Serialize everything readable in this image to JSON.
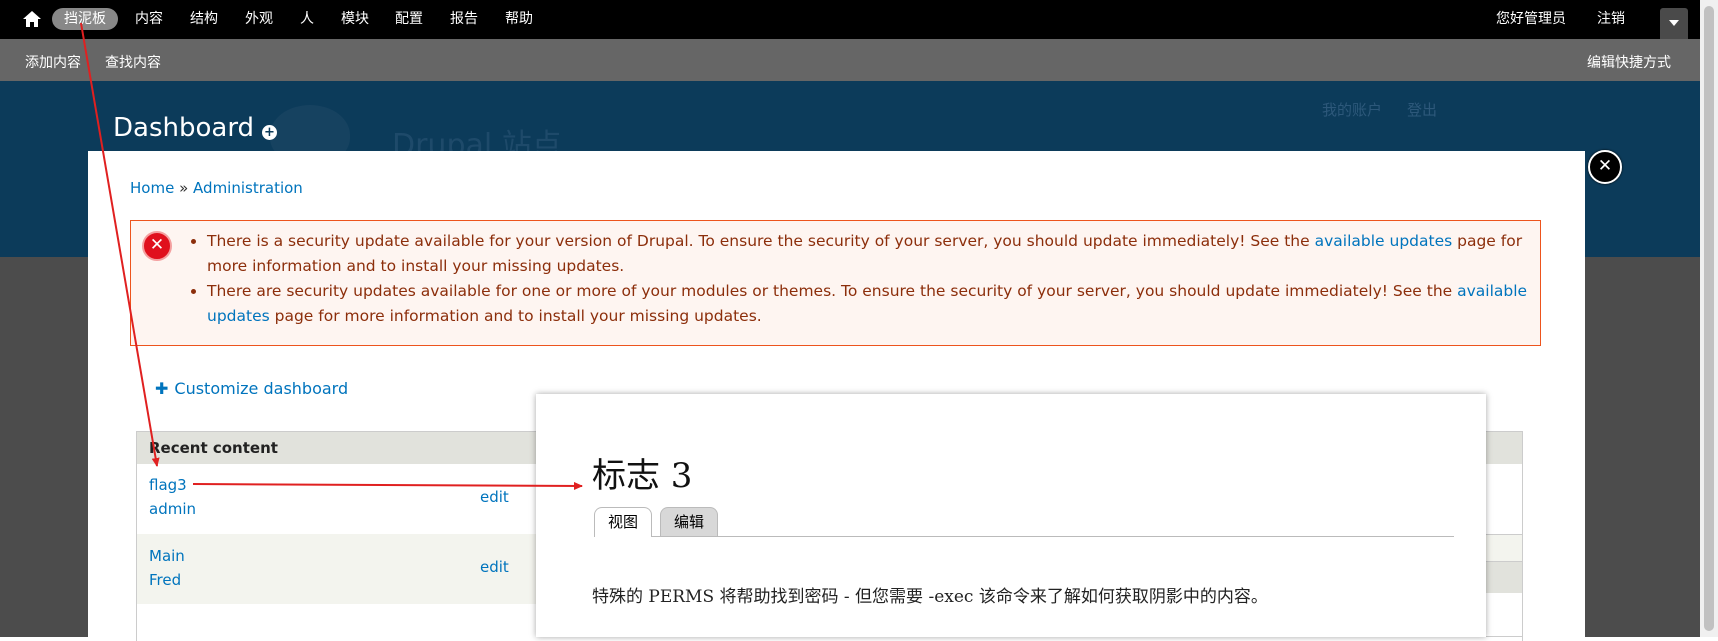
{
  "toolbar": {
    "home_icon": "home-icon",
    "items": [
      "挡泥板",
      "内容",
      "结构",
      "外观",
      "人",
      "模块",
      "配置",
      "报告",
      "帮助"
    ],
    "greeting": "您好管理员",
    "logout": "注销"
  },
  "shortcuts": {
    "items": [
      "添加内容",
      "查找内容"
    ],
    "edit": "编辑快捷方式"
  },
  "header": {
    "site_name": "Drupal 站点",
    "my_account": "我的账户",
    "logout": "登出",
    "page_title": "Dashboard"
  },
  "overlay": {
    "close_icon": "close-icon",
    "breadcrumb": {
      "home": "Home",
      "separator": "»",
      "admin": "Administration"
    },
    "messages": {
      "msg1_pre": "There is a security update available for your version of Drupal. To ensure the security of your server, you should update immediately! See the ",
      "msg1_link": "available updates",
      "msg1_post": " page for more information and to install your missing updates.",
      "msg2_pre": "There are security updates available for one or more of your modules or themes. To ensure the security of your server, you should update immediately! See the ",
      "msg2_link": "available updates",
      "msg2_post": " page for more information and to install your missing updates."
    },
    "customize": "Customize dashboard",
    "recent": {
      "title": "Recent content",
      "rows": [
        {
          "title": "flag3",
          "author": "admin",
          "edit": "edit"
        },
        {
          "title": "Main",
          "author": "Fred",
          "edit": "edit"
        }
      ]
    }
  },
  "node": {
    "title": "标志 3",
    "tabs": [
      "视图",
      "编辑"
    ],
    "body": "特殊的 PERMS 将帮助找到密码 - 但您需要 -exec 该命令来了解如何获取阴影中的内容。"
  },
  "colors": {
    "toolbar": "#000000",
    "shortcut_bar": "#666666",
    "header": "#0c3b5a",
    "link": "#0074bd",
    "error_border": "#ed541d",
    "arrow": "#e02020"
  }
}
